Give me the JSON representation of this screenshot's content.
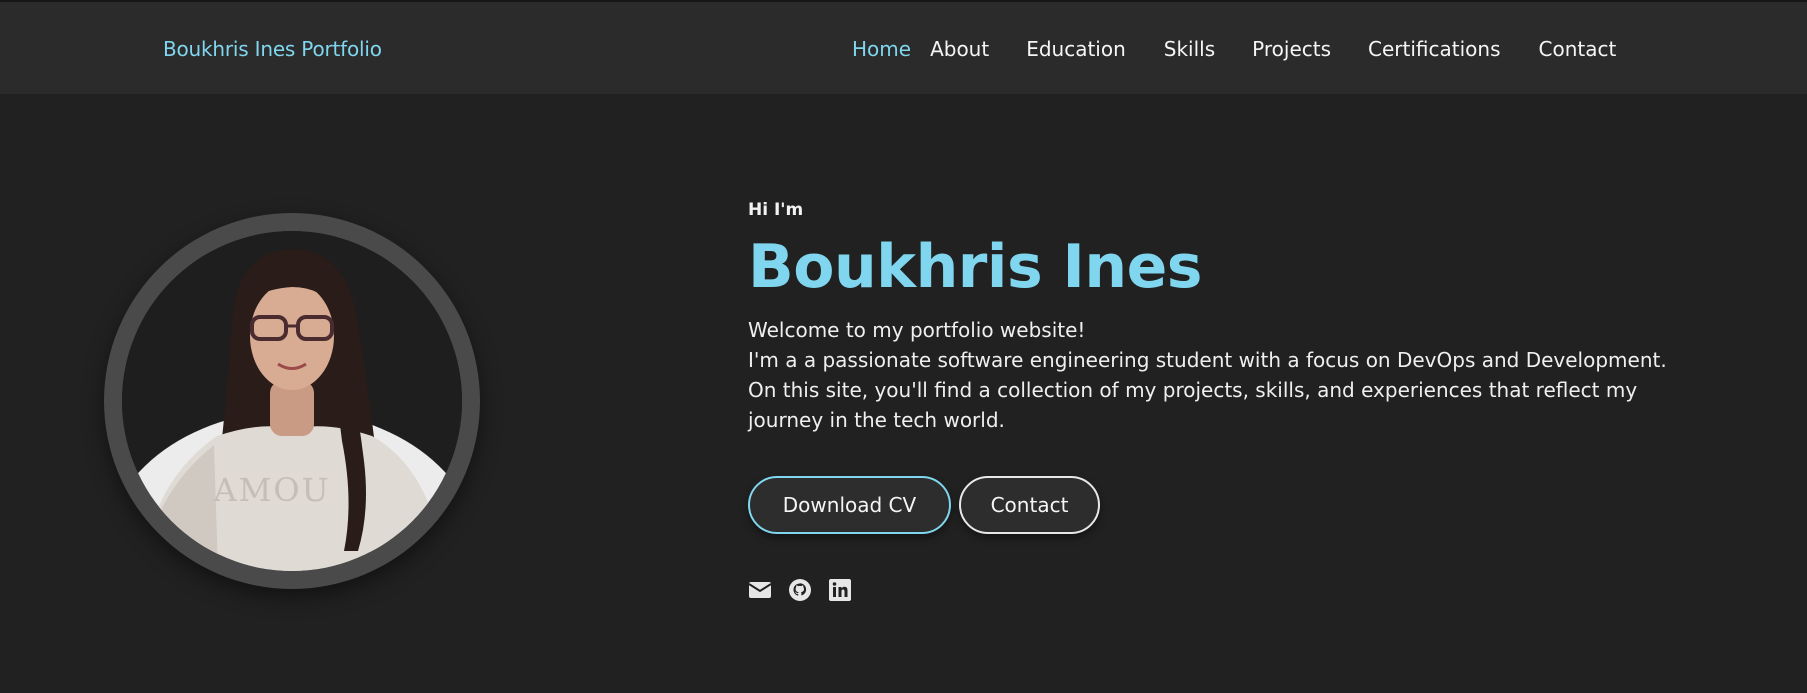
{
  "brand": "Boukhris Ines Portfolio",
  "nav": [
    "Home",
    "About",
    "Education",
    "Skills",
    "Projects",
    "Certifications",
    "Contact"
  ],
  "hero": {
    "greeting": "Hi I'm",
    "name": "Boukhris Ines",
    "welcome": "Welcome to my portfolio website!",
    "description": "I'm a a passionate software engineering student with a focus on DevOps and Development. On this site, you'll find a collection of my projects, skills, and experiences that reflect my journey in the tech world.",
    "download_label": "Download CV",
    "contact_label": "Contact"
  },
  "socials": [
    "envelope-icon",
    "github-icon",
    "linkedin-icon"
  ],
  "colors": {
    "accent": "#7fd6ee",
    "background": "#212121",
    "navbar": "#2b2b2b"
  }
}
